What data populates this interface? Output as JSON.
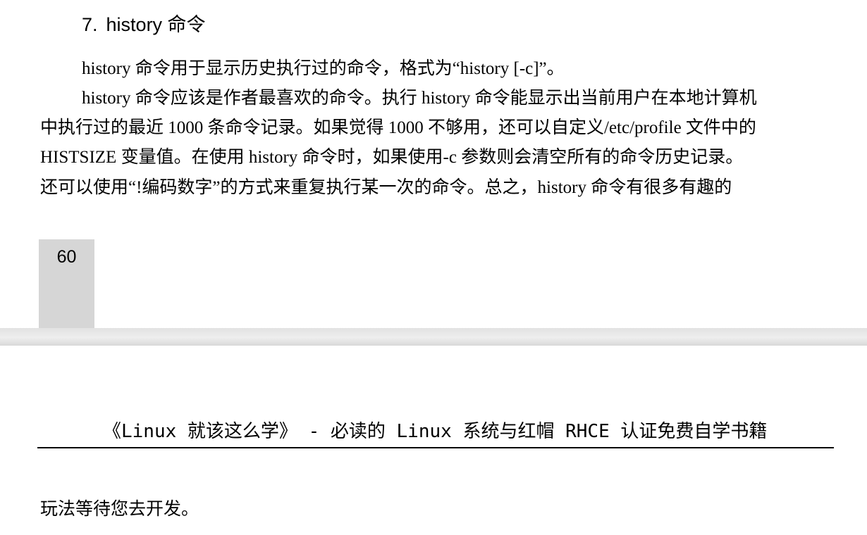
{
  "section": {
    "number": "7.",
    "title": "history 命令"
  },
  "paragraph_lines": [
    "history 命令用于显示历史执行过的命令，格式为“history [-c]”。",
    "history 命令应该是作者最喜欢的命令。执行 history 命令能显示出当前用户在本地计算机",
    "中执行过的最近 1000 条命令记录。如果觉得 1000 不够用，还可以自定义/etc/profile 文件中的",
    "HISTSIZE 变量值。在使用 history 命令时，如果使用-c 参数则会清空所有的命令历史记录。",
    "还可以使用“!编码数字”的方式来重复执行某一次的命令。总之，history 命令有很多有趣的"
  ],
  "page_number": "60",
  "next_page": {
    "header": "《Linux 就该这么学》 - 必读的 Linux 系统与红帽 RHCE 认证免费自学书籍",
    "continuation": "玩法等待您去开发。"
  }
}
